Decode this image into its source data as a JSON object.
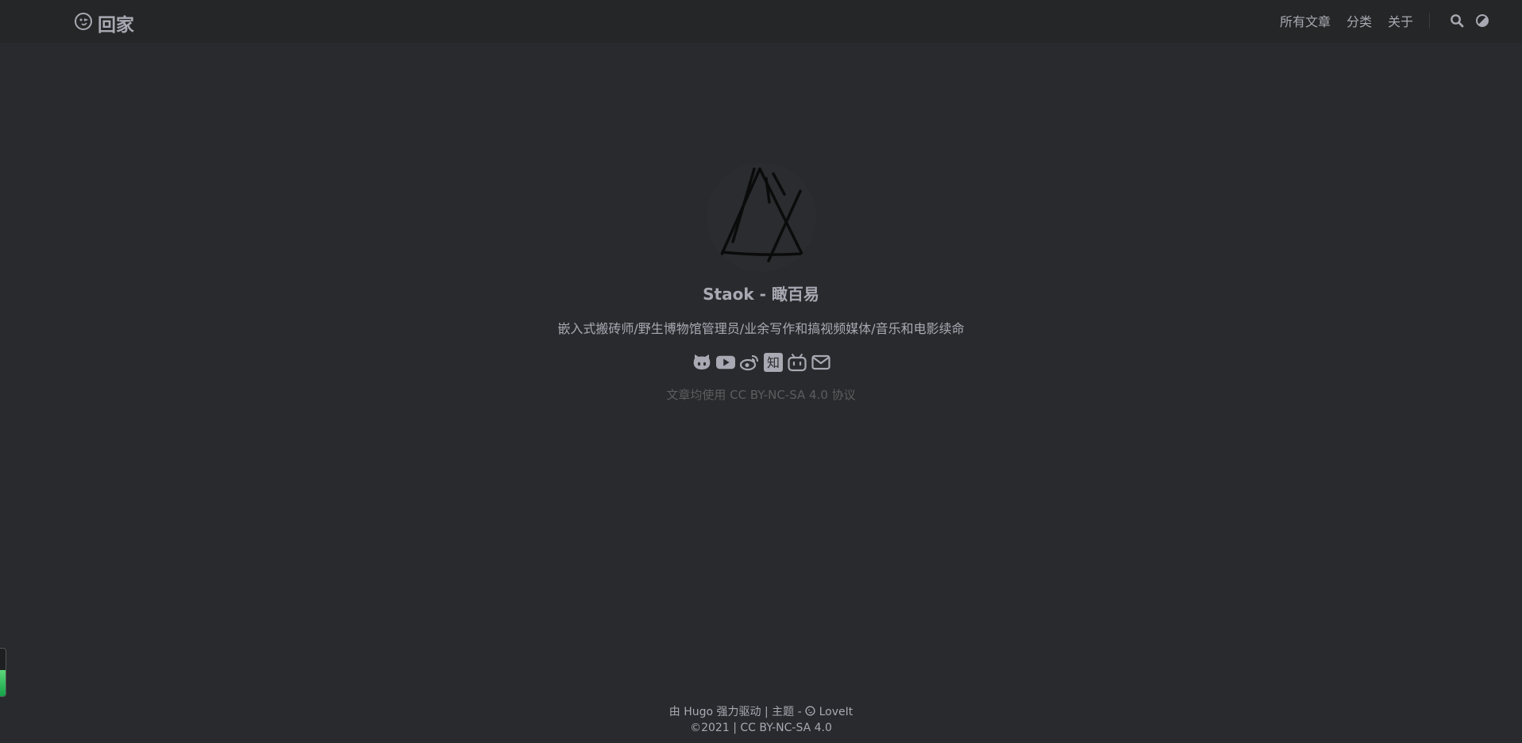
{
  "header": {
    "brand_icon": "ghost-face-icon",
    "brand_text": "回家",
    "nav": [
      {
        "label": "所有文章"
      },
      {
        "label": "分类"
      },
      {
        "label": "关于"
      }
    ],
    "search_icon": "search-icon",
    "theme_icon": "theme-toggle-icon"
  },
  "profile": {
    "title": "Staok - 瞰百易",
    "subtitle": "嵌入式搬砖师/野生博物馆管理员/业余写作和搞视频媒体/音乐和电影续命",
    "social_icons": [
      "github-icon",
      "youtube-icon",
      "weibo-icon",
      "zhihu-icon",
      "bilibili-icon",
      "email-icon"
    ],
    "zhihu_text": "知",
    "license": "文章均使用 CC BY-NC-SA 4.0 协议"
  },
  "footer": {
    "line1_prefix": "由",
    "hugo": "Hugo",
    "line1_mid": "强力驱动 | 主题 -",
    "theme": "LoveIt",
    "line2_symbol": "©",
    "line2": "2021 | CC BY-NC-SA 4.0"
  },
  "scroll_progress": 0.55,
  "colors": {
    "background": "#292a2d",
    "header": "#252627",
    "text": "#a9a9b3",
    "muted": "#5d5d5f",
    "progress": "#22c55e"
  }
}
